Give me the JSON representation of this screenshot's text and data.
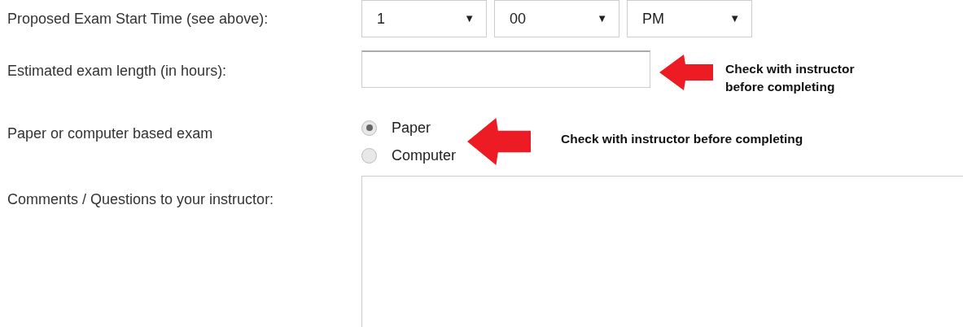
{
  "fields": [
    {
      "kind": "time",
      "label": "Proposed Exam Start Time (see above):",
      "selects": [
        {
          "value": "1",
          "caret": "▼"
        },
        {
          "value": "00",
          "caret": "▼"
        },
        {
          "value": "PM",
          "caret": "▼"
        }
      ]
    },
    {
      "kind": "text",
      "label": "Estimated exam length (in hours):",
      "note": "Check with instructor before completing"
    },
    {
      "kind": "radio",
      "label": "Paper or computer based exam",
      "options": [
        {
          "label": "Paper",
          "selected": true
        },
        {
          "label": "Computer",
          "selected": false
        }
      ],
      "note": "Check with instructor before completing"
    },
    {
      "kind": "textarea",
      "label": "Comments / Questions to your instructor:"
    }
  ]
}
